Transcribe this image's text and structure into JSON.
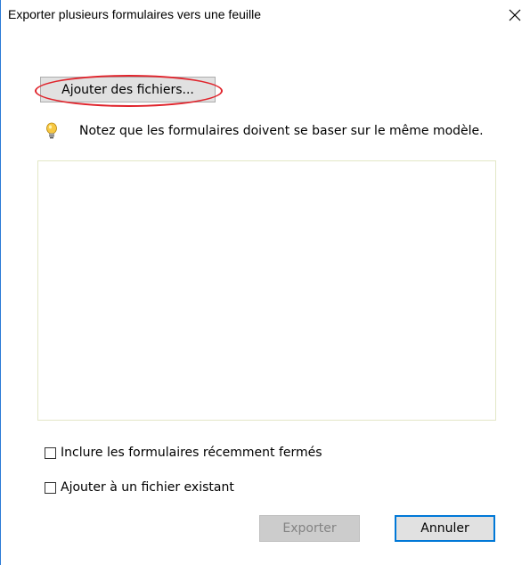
{
  "window": {
    "title": "Exporter plusieurs formulaires vers une feuille"
  },
  "toolbar": {
    "add_files_label": "Ajouter des fichiers..."
  },
  "tip": {
    "icon": "lightbulb-icon",
    "text": "Notez que les formulaires doivent se baser sur le même modèle."
  },
  "file_list": {
    "items": []
  },
  "options": {
    "include_recent_label": "Inclure les formulaires récemment fermés",
    "include_recent_checked": false,
    "append_existing_label": "Ajouter à un fichier existant",
    "append_existing_checked": false
  },
  "buttons": {
    "export_label": "Exporter",
    "export_enabled": false,
    "cancel_label": "Annuler"
  },
  "colors": {
    "window_border": "#2b7bd6",
    "highlight_ring": "#e0242c",
    "focus_border": "#0078d7",
    "list_border": "#e3e7c7"
  }
}
